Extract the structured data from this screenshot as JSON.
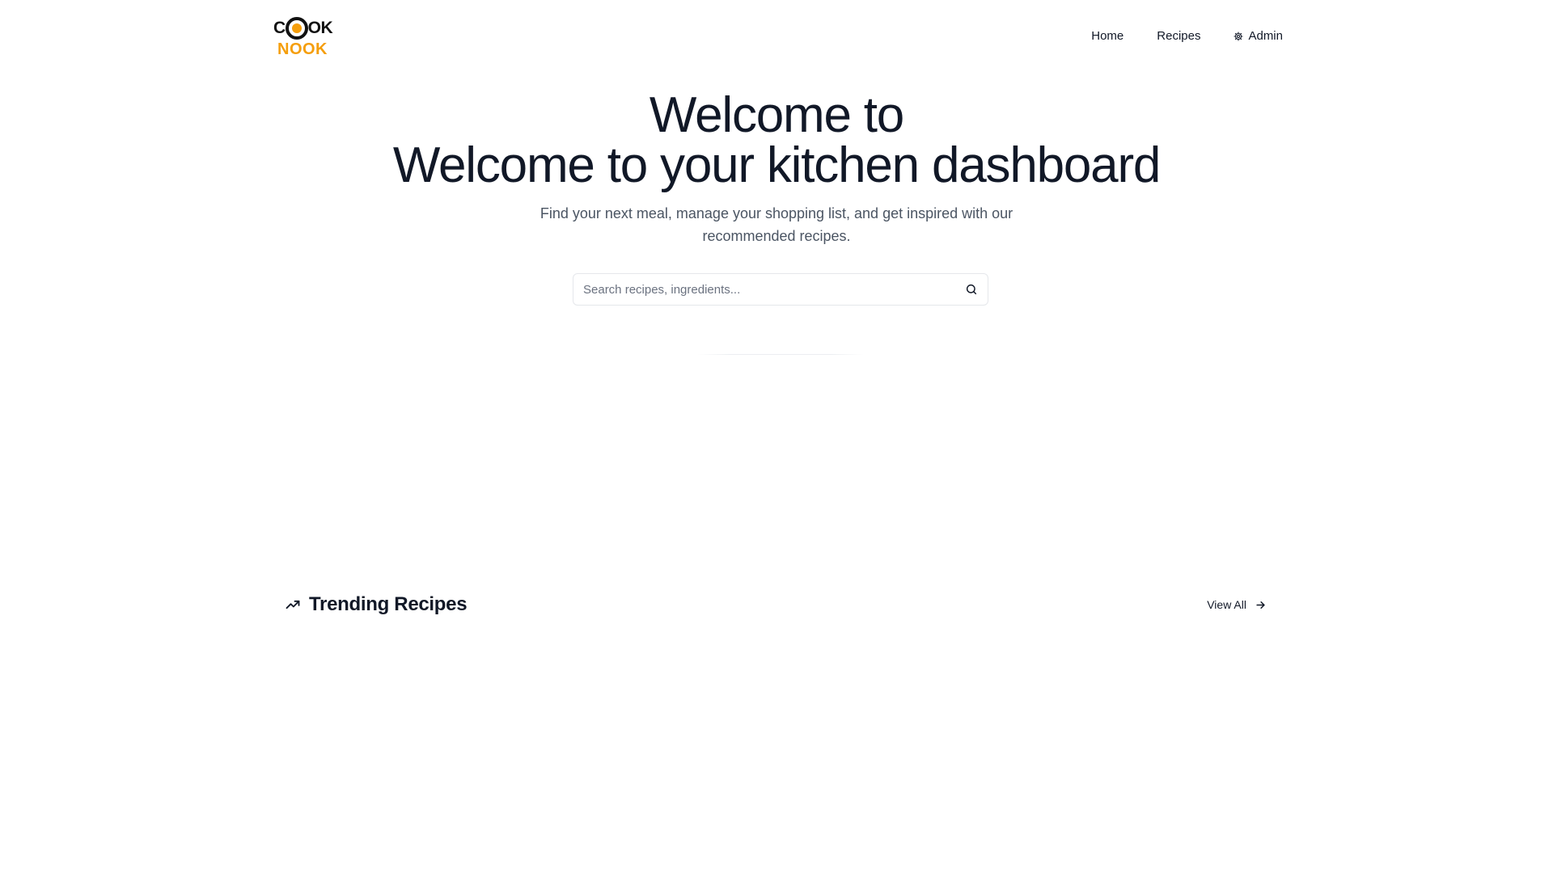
{
  "brand": {
    "top_left": "C",
    "top_right": "OK",
    "bottom": "NOOK",
    "accent": "#f59e0b"
  },
  "nav": {
    "home": "Home",
    "recipes": "Recipes",
    "admin": "Admin",
    "admin_icon": "gear-icon"
  },
  "hero": {
    "title_line1": "Welcome to",
    "title_line2": "Welcome to your kitchen dashboard",
    "subtitle": "Find your next meal, manage your shopping list, and get inspired with our recommended recipes."
  },
  "search": {
    "placeholder": "Search recipes, ingredients...",
    "value": "",
    "icon": "search-icon"
  },
  "trending": {
    "icon": "trending-up-icon",
    "title": "Trending Recipes",
    "view_all": "View All",
    "view_all_icon": "arrow-right-icon"
  }
}
